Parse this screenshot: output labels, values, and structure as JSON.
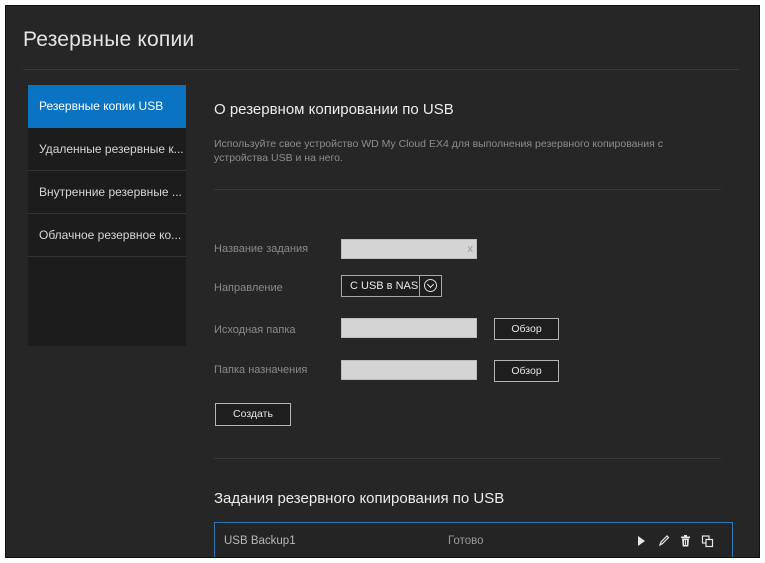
{
  "page": {
    "title": "Резервные копии"
  },
  "sidebar": {
    "items": [
      {
        "label": "Резервные копии USB",
        "active": true
      },
      {
        "label": "Удаленные резервные к...",
        "active": false
      },
      {
        "label": "Внутренние резервные ...",
        "active": false
      },
      {
        "label": "Облачное резервное ко...",
        "active": false
      }
    ]
  },
  "usb_backup": {
    "title": "О резервном копировании по USB",
    "description": "Используйте свое устройство WD My Cloud EX4 для выполнения резервного копирования с устройства USB и на него."
  },
  "form": {
    "job_name": {
      "label": "Название задания",
      "value": "",
      "clear_icon": "x"
    },
    "direction": {
      "label": "Направление",
      "value": "C USB в NAS"
    },
    "source_folder": {
      "label": "Исходная папка",
      "value": "",
      "browse_label": "Обзор"
    },
    "destination_folder": {
      "label": "Папка назначения",
      "value": "",
      "browse_label": "Обзор"
    },
    "create_label": "Создать"
  },
  "jobs": {
    "title": "Задания резервного копирования по USB",
    "rows": [
      {
        "name": "USB Backup1",
        "status": "Готово",
        "actions": [
          "play-icon",
          "edit-icon",
          "trash-icon",
          "restore-icon"
        ]
      }
    ]
  },
  "colors": {
    "background": "#262626",
    "sidebar": "#1c1c1c",
    "accent": "#0a73c2",
    "row_border": "#2f78b5"
  }
}
